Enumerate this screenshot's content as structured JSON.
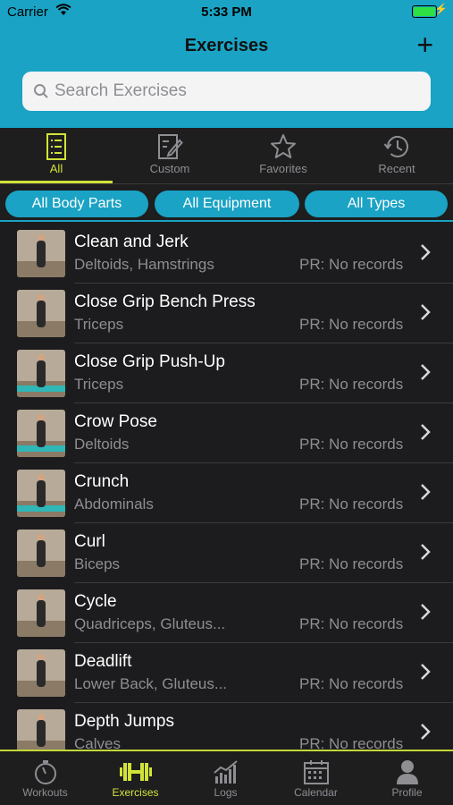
{
  "status": {
    "carrier": "Carrier",
    "time": "5:33 PM"
  },
  "header": {
    "title": "Exercises",
    "add": "+"
  },
  "search": {
    "placeholder": "Search Exercises"
  },
  "tabs": [
    {
      "label": "All",
      "icon": "list-icon"
    },
    {
      "label": "Custom",
      "icon": "edit-icon"
    },
    {
      "label": "Favorites",
      "icon": "star-icon"
    },
    {
      "label": "Recent",
      "icon": "history-icon"
    }
  ],
  "filters": [
    {
      "label": "All Body Parts"
    },
    {
      "label": "All Equipment"
    },
    {
      "label": "All Types"
    }
  ],
  "exercises": [
    {
      "name": "Clean and Jerk",
      "muscles": "Deltoids, Hamstrings",
      "pr": "PR: No records"
    },
    {
      "name": "Close Grip Bench Press",
      "muscles": "Triceps",
      "pr": "PR: No records"
    },
    {
      "name": "Close Grip Push-Up",
      "muscles": "Triceps",
      "pr": "PR: No records"
    },
    {
      "name": "Crow Pose",
      "muscles": "Deltoids",
      "pr": "PR: No records"
    },
    {
      "name": "Crunch",
      "muscles": "Abdominals",
      "pr": "PR: No records"
    },
    {
      "name": "Curl",
      "muscles": "Biceps",
      "pr": "PR: No records"
    },
    {
      "name": "Cycle",
      "muscles": "Quadriceps, Gluteus...",
      "pr": "PR: No records"
    },
    {
      "name": "Deadlift",
      "muscles": "Lower Back, Gluteus...",
      "pr": "PR: No records"
    },
    {
      "name": "Depth Jumps",
      "muscles": "Calves",
      "pr": "PR: No records"
    }
  ],
  "bottom_tabs": [
    {
      "label": "Workouts",
      "icon": "stopwatch-icon"
    },
    {
      "label": "Exercises",
      "icon": "dumbbell-icon"
    },
    {
      "label": "Logs",
      "icon": "chart-icon"
    },
    {
      "label": "Calendar",
      "icon": "calendar-icon"
    },
    {
      "label": "Profile",
      "icon": "person-icon"
    }
  ],
  "colors": {
    "accent": "#1aa3c4",
    "active": "#d1e338",
    "background": "#1c1c1e"
  }
}
